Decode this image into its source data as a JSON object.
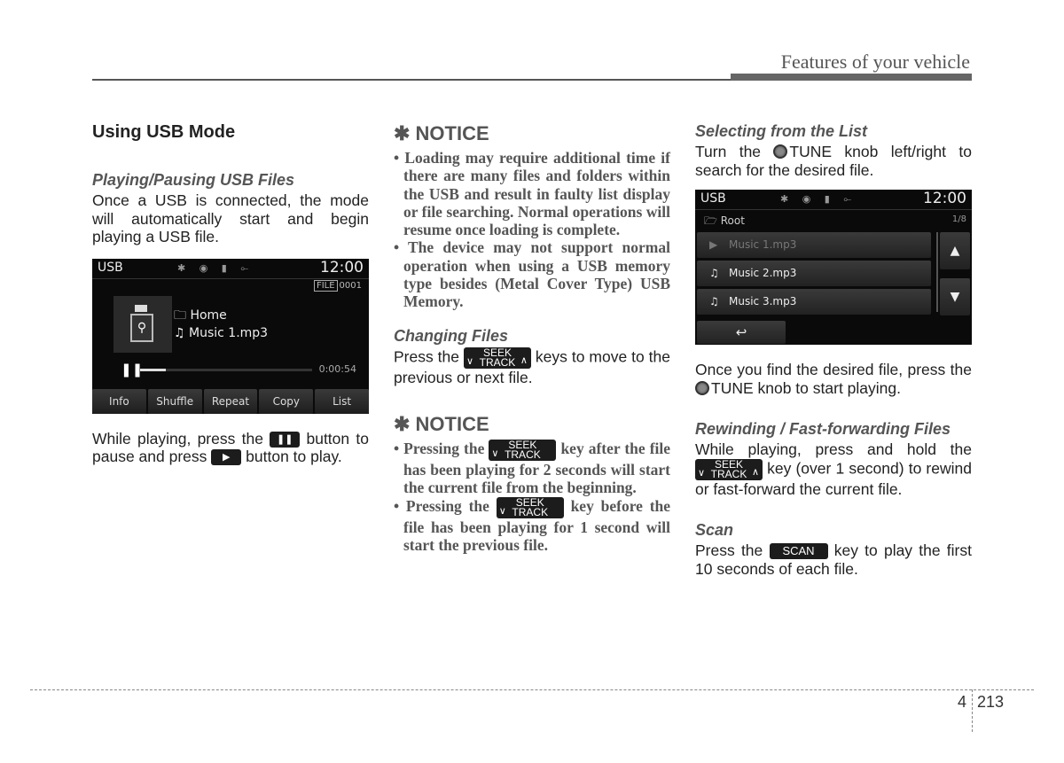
{
  "header": {
    "title": "Features of your vehicle"
  },
  "column1": {
    "section_title": "Using USB Mode",
    "sub1": "Playing/Pausing USB Files",
    "para1": "Once a USB is connected, the mode will automatically start and begin playing a USB file.",
    "screen": {
      "source": "USB",
      "status_icons": "✱ ◉ ▮ ⟜",
      "time": "12:00",
      "file_label": "FILE",
      "file_number": "0001",
      "folder": "Home",
      "track": "Music 1.mp3",
      "progress_percent": 15,
      "elapsed": "0:00:54",
      "softkeys": [
        "Info",
        "Shuffle",
        "Repeat",
        "Copy",
        "List"
      ]
    },
    "para2_a": "While playing, press the",
    "para2_b": "button to pause and press",
    "para2_c": "button to play.",
    "pause_key_icon": "❚❚",
    "play_key_icon": "▶"
  },
  "column2": {
    "notice1_title": "✱ NOTICE",
    "notice1_items": [
      "• Loading may require additional time if there are many files and folders within the USB and result in faulty list display or file searching. Normal operations will resume once loading is complete.",
      "• The device may not support normal operation when using a USB memory type besides (Metal Cover Type) USB Memory."
    ],
    "sub_changing": "Changing Files",
    "changing_a": "Press the",
    "changing_b": "keys to move to the previous or next file.",
    "seek_top": "SEEK",
    "seek_bottom": "TRACK",
    "notice2_title": "✱ NOTICE",
    "notice2_item1_a": "• Pressing the",
    "notice2_item1_b": "key after the file has been playing for 2 seconds will start the current file from the beginning.",
    "notice2_item2_a": "• Pressing the",
    "notice2_item2_b": "key before the file has been playing for 1 second will start the previous file."
  },
  "column3": {
    "sub_select": "Selecting from the List",
    "select_a": "Turn the",
    "select_b": "TUNE knob left/right to search for the desired file.",
    "screen": {
      "source": "USB",
      "status_icons": "✱ ◉ ▮ ⟜",
      "time": "12:00",
      "path": "Root",
      "count": "1/8",
      "rows": [
        {
          "icon": "▶",
          "label": "Music 1.mp3"
        },
        {
          "icon": "♫",
          "label": "Music 2.mp3"
        },
        {
          "icon": "♫",
          "label": "Music 3.mp3"
        }
      ],
      "up_icon": "▲",
      "down_icon": "▼",
      "back_icon": "↩"
    },
    "found_a": "Once you find the desired file, press the",
    "found_b": "TUNE knob to start playing.",
    "sub_rewind": "Rewinding / Fast-forwarding Files",
    "rewind_a": "While playing, press and hold the",
    "rewind_b": "key (over 1 second) to rewind or fast-forward the current file.",
    "sub_scan": "Scan",
    "scan_a": "Press the",
    "scan_key": "SCAN",
    "scan_b": "key to play the first 10 seconds of each file."
  },
  "footer": {
    "chapter": "4",
    "page": "213"
  }
}
